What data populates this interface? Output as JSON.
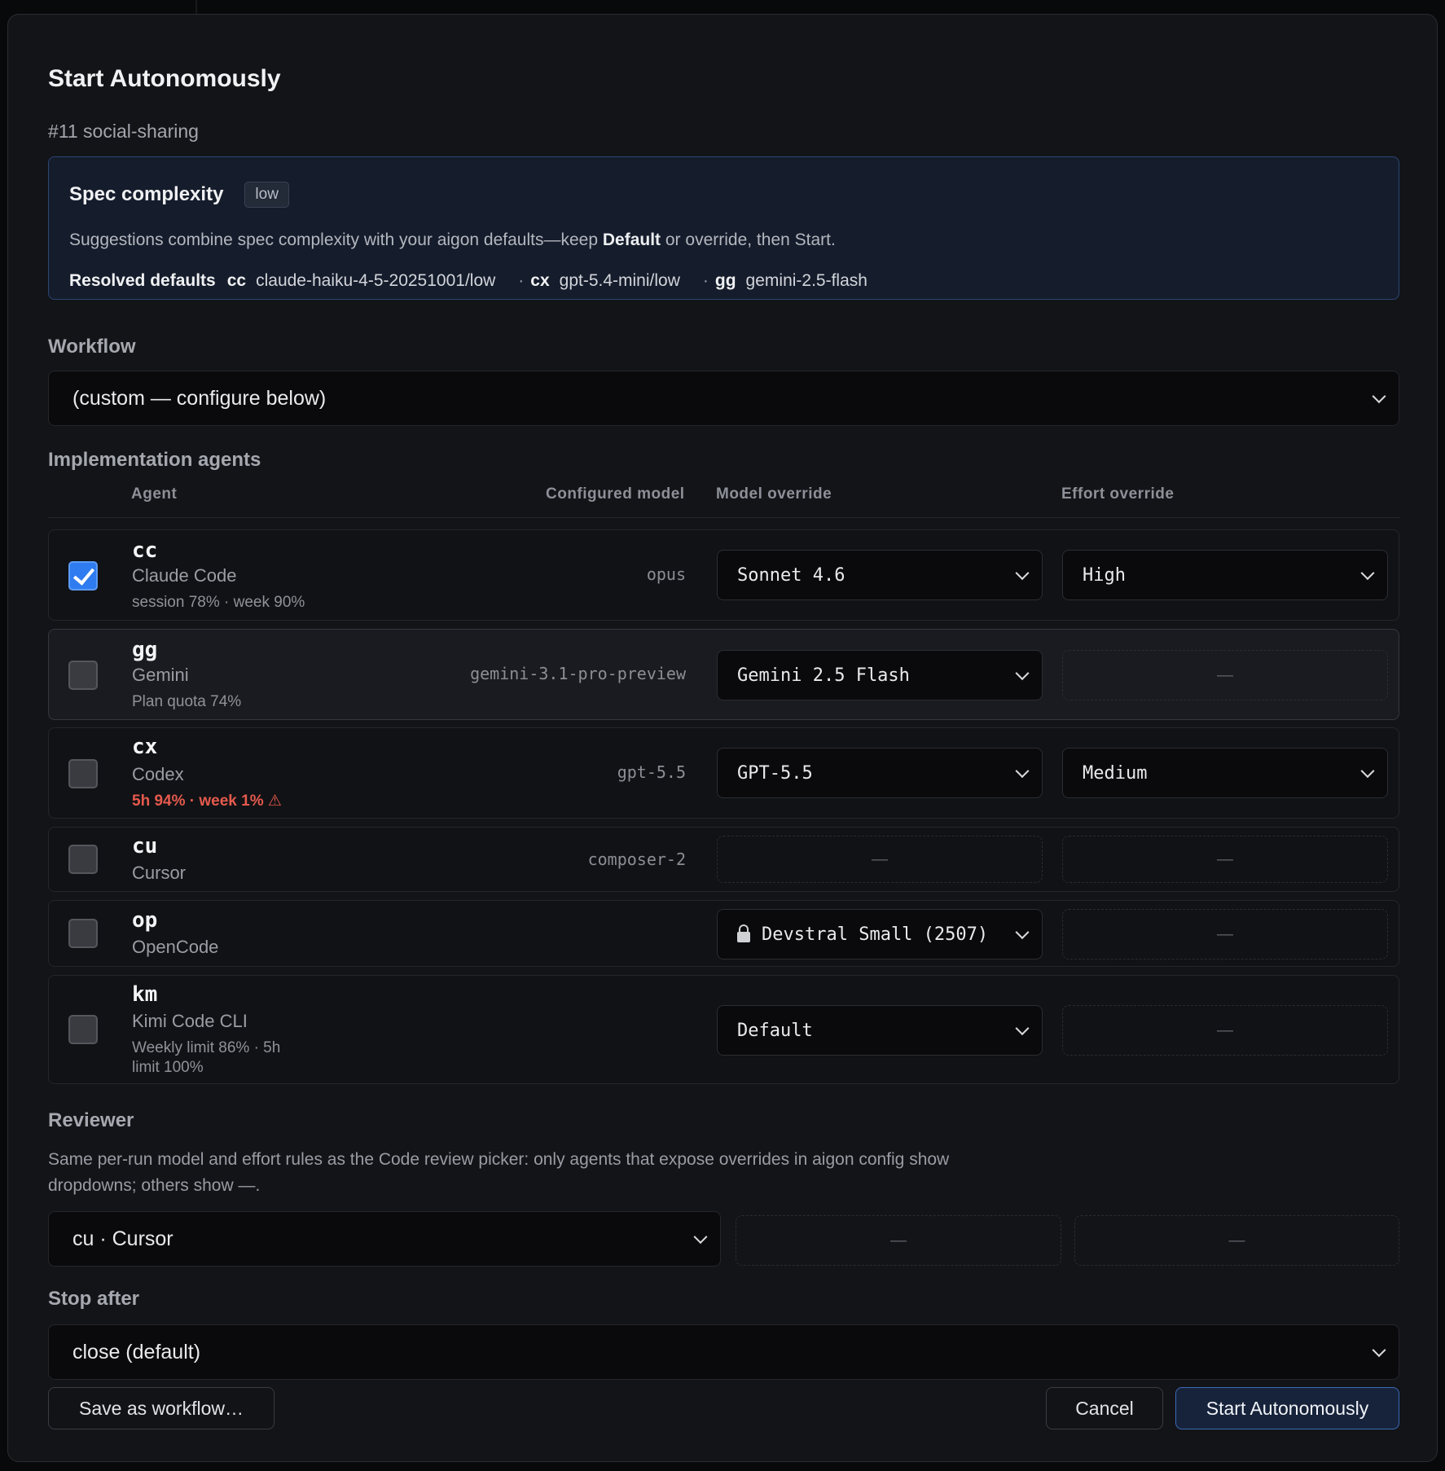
{
  "dialog": {
    "title": "Start Autonomously",
    "subtitle": "#11 social-sharing"
  },
  "spec": {
    "title": "Spec complexity",
    "badge": "low",
    "desc_before": "Suggestions combine spec complexity with your aigon defaults—keep ",
    "desc_bold": "Default",
    "desc_after": " or override, then Start.",
    "defaults_label": "Resolved defaults",
    "defaults": [
      {
        "code": "cc",
        "value": "claude-haiku-4-5-20251001/low"
      },
      {
        "code": "cx",
        "value": "gpt-5.4-mini/low"
      },
      {
        "code": "gg",
        "value": "gemini-2.5-flash"
      }
    ],
    "separator": "·"
  },
  "workflow": {
    "label": "Workflow",
    "selected": "(custom — configure below)"
  },
  "implementation": {
    "label": "Implementation agents",
    "columns": {
      "agent": "Agent",
      "configured": "Configured model",
      "model_override": "Model override",
      "effort_override": "Effort override"
    },
    "agents": [
      {
        "code": "cc",
        "name": "Claude Code",
        "usage": "session 78% · week 90%",
        "configured": "opus",
        "model": "Sonnet 4.6",
        "effort": "High",
        "checked": true
      },
      {
        "code": "gg",
        "name": "Gemini",
        "usage": "Plan quota 74%",
        "configured": "gemini-3.1-pro-preview",
        "model": "Gemini 2.5 Flash",
        "effort": "—",
        "checked": false
      },
      {
        "code": "cx",
        "name": "Codex",
        "usage": "5h 94% · week 1% ⚠",
        "configured": "gpt-5.5",
        "model": "GPT-5.5",
        "effort": "Medium",
        "checked": false
      },
      {
        "code": "cu",
        "name": "Cursor",
        "usage": "",
        "configured": "composer-2",
        "model": "—",
        "effort": "—",
        "checked": false
      },
      {
        "code": "op",
        "name": "OpenCode",
        "usage": "",
        "configured": "",
        "model": "Devstral Small (2507)",
        "effort": "—",
        "checked": false
      },
      {
        "code": "km",
        "name": "Kimi Code CLI",
        "usage_line1": "Weekly limit 86% · 5h",
        "usage_line2": "limit 100%",
        "configured": "",
        "model": "Default",
        "effort": "—",
        "checked": false
      }
    ]
  },
  "reviewer": {
    "label": "Reviewer",
    "desc": "Same per-run model and effort rules as the Code review picker: only agents that expose overrides in aigon config show dropdowns; others show —.",
    "selected": "cu · Cursor",
    "model": "—",
    "effort": "—"
  },
  "stop_after": {
    "label": "Stop after",
    "selected": "close (default)"
  },
  "footer": {
    "save_label": "Save as workflow…",
    "cancel_label": "Cancel",
    "start_label": "Start Autonomously"
  },
  "colors": {
    "accent": "#2f7cf0",
    "warning": "#e55a4e",
    "spec_border": "#2b4673"
  }
}
